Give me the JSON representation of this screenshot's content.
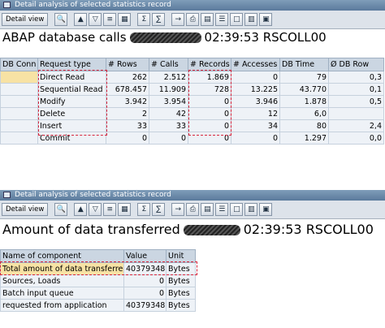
{
  "top": {
    "window_title": "Detail analysis of selected statistics record",
    "detail_view_label": "Detail view",
    "heading_prefix": "ABAP database calls",
    "heading_time": "02:39:53",
    "heading_host": "RSCOLL00",
    "columns": [
      "DB Conn",
      "Request type",
      "# Rows",
      "# Calls",
      "# Records",
      "# Accesses",
      "DB Time",
      "Ø DB Row"
    ],
    "rows": [
      [
        "",
        "Direct Read",
        "262",
        "2.512",
        "1.869",
        "0",
        "79",
        "0,3"
      ],
      [
        "",
        "Sequential Read",
        "678.457",
        "11.909",
        "728",
        "13.225",
        "43.770",
        "0,1"
      ],
      [
        "",
        "Modify",
        "3.942",
        "3.954",
        "0",
        "3.946",
        "1.878",
        "0,5"
      ],
      [
        "",
        "Delete",
        "2",
        "42",
        "0",
        "12",
        "6,0",
        ""
      ],
      [
        "",
        "Insert",
        "33",
        "33",
        "0",
        "34",
        "80",
        "2,4"
      ],
      [
        "",
        "Commit",
        "0",
        "0",
        "0",
        "0",
        "1.297",
        "0,0"
      ]
    ]
  },
  "bottom": {
    "window_title": "Detail analysis of selected statistics record",
    "detail_view_label": "Detail view",
    "heading_prefix": "Amount of data transferred",
    "heading_time": "02:39:53",
    "heading_host": "RSCOLL00",
    "columns": [
      "Name of component",
      "Value",
      "Unit"
    ],
    "rows": [
      [
        "Total amount of data transferred",
        "40379348",
        "Bytes"
      ],
      [
        "Sources, Loads",
        "0",
        "Bytes"
      ],
      [
        "Batch input queue",
        "0",
        "Bytes"
      ],
      [
        "requested from application",
        "40379348",
        "Bytes"
      ]
    ]
  },
  "icons": {
    "top_toolbar": [
      "find-icon",
      "sort-ascending-icon",
      "filter-icon",
      "find-next-icon",
      "layout-icon",
      "sum-icon",
      "subtotal-icon",
      "export-icon",
      "print-icon",
      "spreadsheet-icon",
      "word-processor-icon",
      "local-file-icon",
      "graphic-icon",
      "details-icon"
    ],
    "bottom_toolbar": [
      "find-icon",
      "sort-ascending-icon",
      "filter-icon",
      "find-next-icon",
      "layout-icon",
      "sum-icon",
      "subtotal-icon",
      "export-icon",
      "print-icon",
      "spreadsheet-icon",
      "word-processor-icon",
      "local-file-icon",
      "graphic-icon",
      "details-icon"
    ]
  },
  "colors": {
    "title_bar": "#5b7a9c",
    "header_cell": "#cbd6e2",
    "selected_cell": "#f7e2a4",
    "highlight_outline": "#d7263d"
  }
}
